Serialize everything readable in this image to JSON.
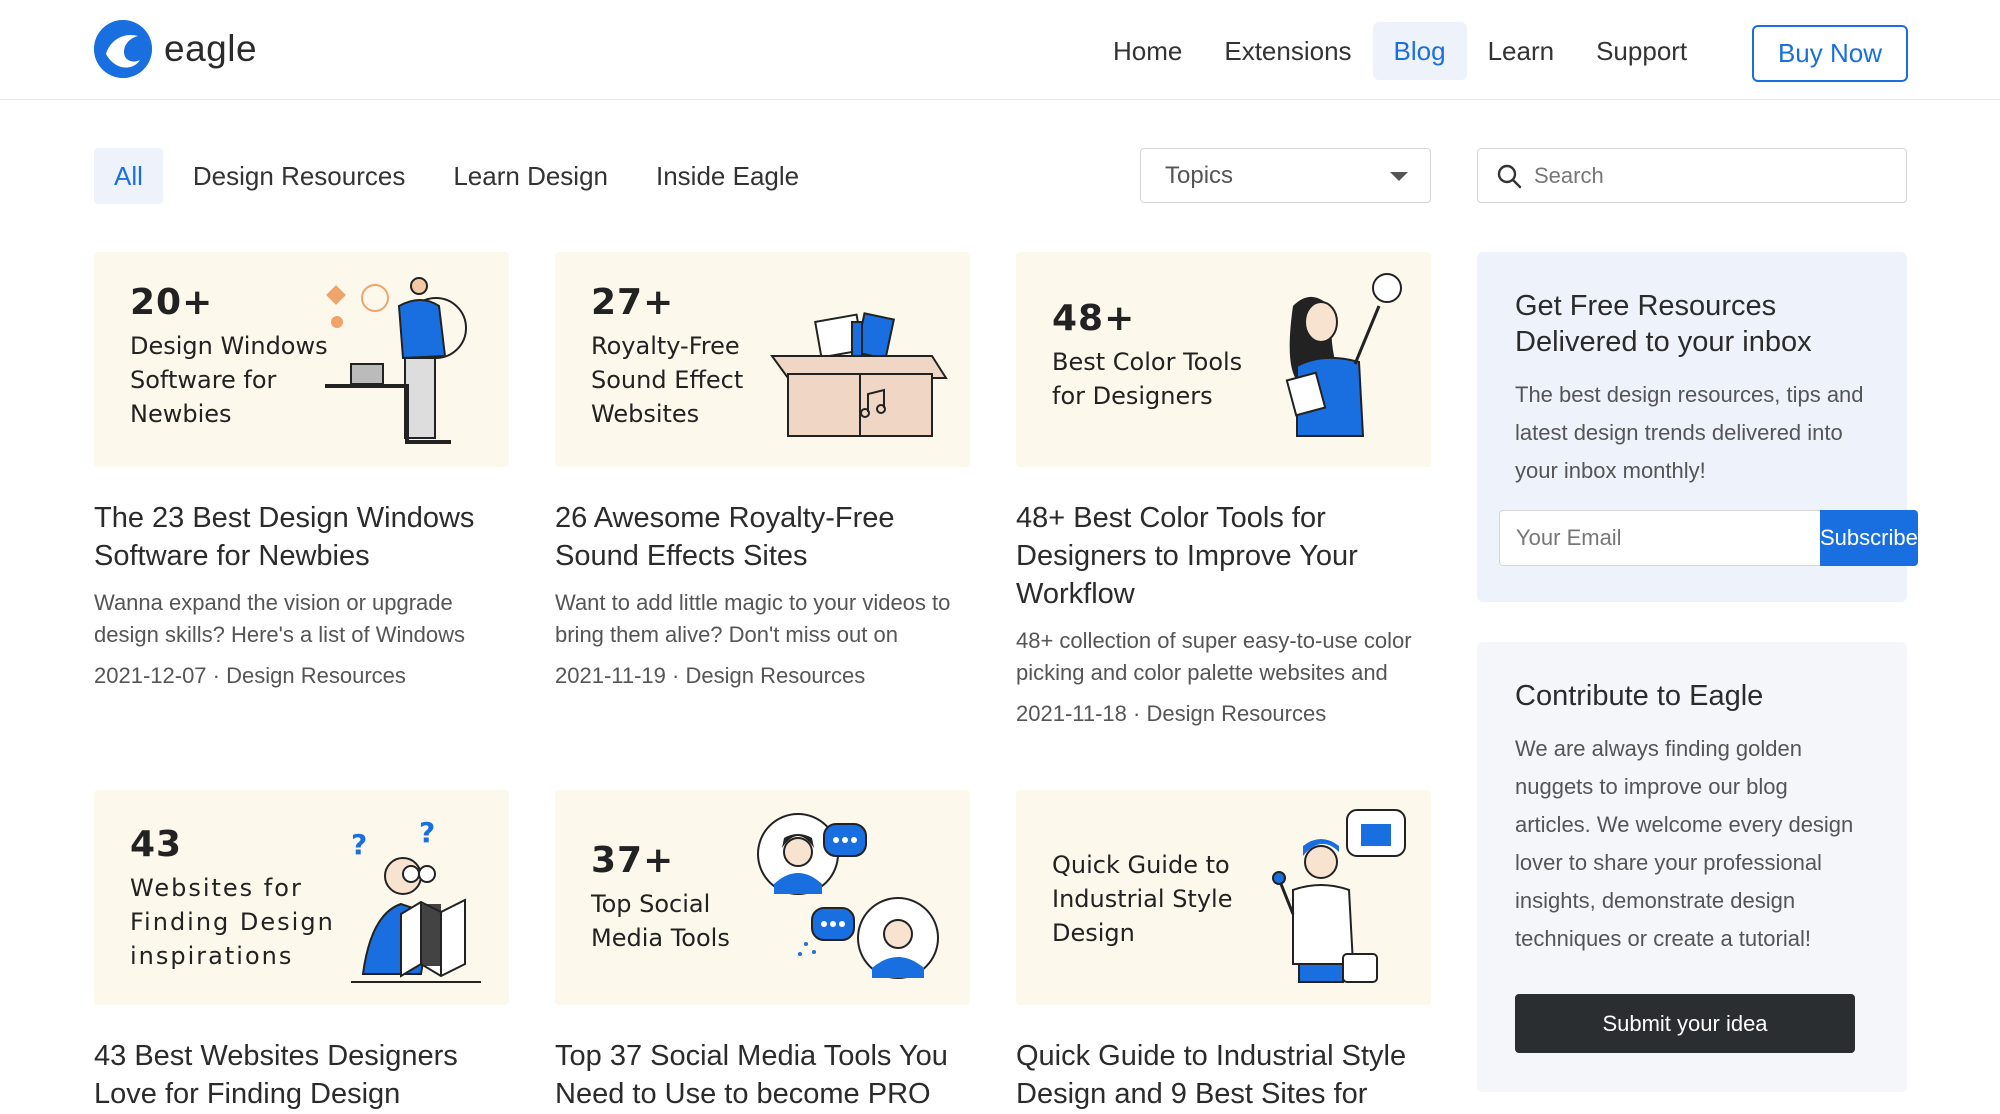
{
  "header": {
    "logo_text": "eagle",
    "nav": [
      {
        "label": "Home"
      },
      {
        "label": "Extensions"
      },
      {
        "label": "Blog",
        "active": true
      },
      {
        "label": "Learn"
      },
      {
        "label": "Support"
      }
    ],
    "buy_label": "Buy Now"
  },
  "filters": {
    "tabs": [
      {
        "label": "All",
        "active": true
      },
      {
        "label": "Design Resources"
      },
      {
        "label": "Learn Design"
      },
      {
        "label": "Inside Eagle"
      }
    ],
    "topics_label": "Topics",
    "search_placeholder": "Search"
  },
  "cards": [
    {
      "thumb_num": "20+",
      "thumb_label": [
        "Design Windows",
        "Software for",
        "Newbies"
      ],
      "title": "The 23 Best Design Windows Software for Newbies",
      "desc": "Wanna expand the vision or upgrade design skills? Here's a list of Windows",
      "date": "2021-12-07",
      "category": "Design Resources"
    },
    {
      "thumb_num": "27+",
      "thumb_label": [
        "Royalty-Free",
        "Sound Effect",
        "Websites"
      ],
      "title": "26 Awesome Royalty-Free Sound Effects Sites",
      "desc": "Want to add little magic to your videos to bring them alive? Don't miss out on",
      "date": "2021-11-19",
      "category": "Design Resources"
    },
    {
      "thumb_num": "48+",
      "thumb_label": [
        "Best Color Tools",
        "for Designers"
      ],
      "title": "48+ Best Color Tools for Designers to Improve Your Workflow",
      "desc": "48+ collection of super easy-to-use color picking and color palette websites and",
      "date": "2021-11-18",
      "category": "Design Resources"
    },
    {
      "thumb_num": "43",
      "thumb_label": [
        "Websites for",
        "Finding Design",
        "inspirations"
      ],
      "title": "43 Best Websites Designers Love for Finding Design",
      "desc": "",
      "date": "",
      "category": ""
    },
    {
      "thumb_num": "37+",
      "thumb_label": [
        "Top Social",
        "Media Tools"
      ],
      "title": "Top 37 Social Media Tools You Need to Use to become PRO",
      "desc": "",
      "date": "",
      "category": ""
    },
    {
      "thumb_num": "",
      "thumb_label": [
        "Quick Guide to",
        "Industrial Style",
        "Design"
      ],
      "title": "Quick Guide to Industrial Style Design and 9 Best Sites for",
      "desc": "",
      "date": "",
      "category": ""
    }
  ],
  "newsletter": {
    "title": "Get Free Resources Delivered to your inbox",
    "body": "The best design resources, tips and latest design trends delivered into your inbox monthly!",
    "email_placeholder": "Your Email",
    "subscribe_label": "Subscribe"
  },
  "contribute": {
    "title": "Contribute to Eagle",
    "body": "We are always finding golden nuggets to improve our blog articles. We welcome every design lover to share your professional insights, demonstrate design techniques or create a tutorial!",
    "button_label": "Submit your idea"
  },
  "colors": {
    "accent": "#1a6fe0",
    "thumb_bg": "#fdf8ec",
    "panel_blue": "#eef3fb",
    "panel_gray": "#f4f6f9",
    "dark_button": "#2b2e31"
  },
  "icons": [
    "eagle-logo-icon",
    "caret-down-icon",
    "search-icon"
  ]
}
